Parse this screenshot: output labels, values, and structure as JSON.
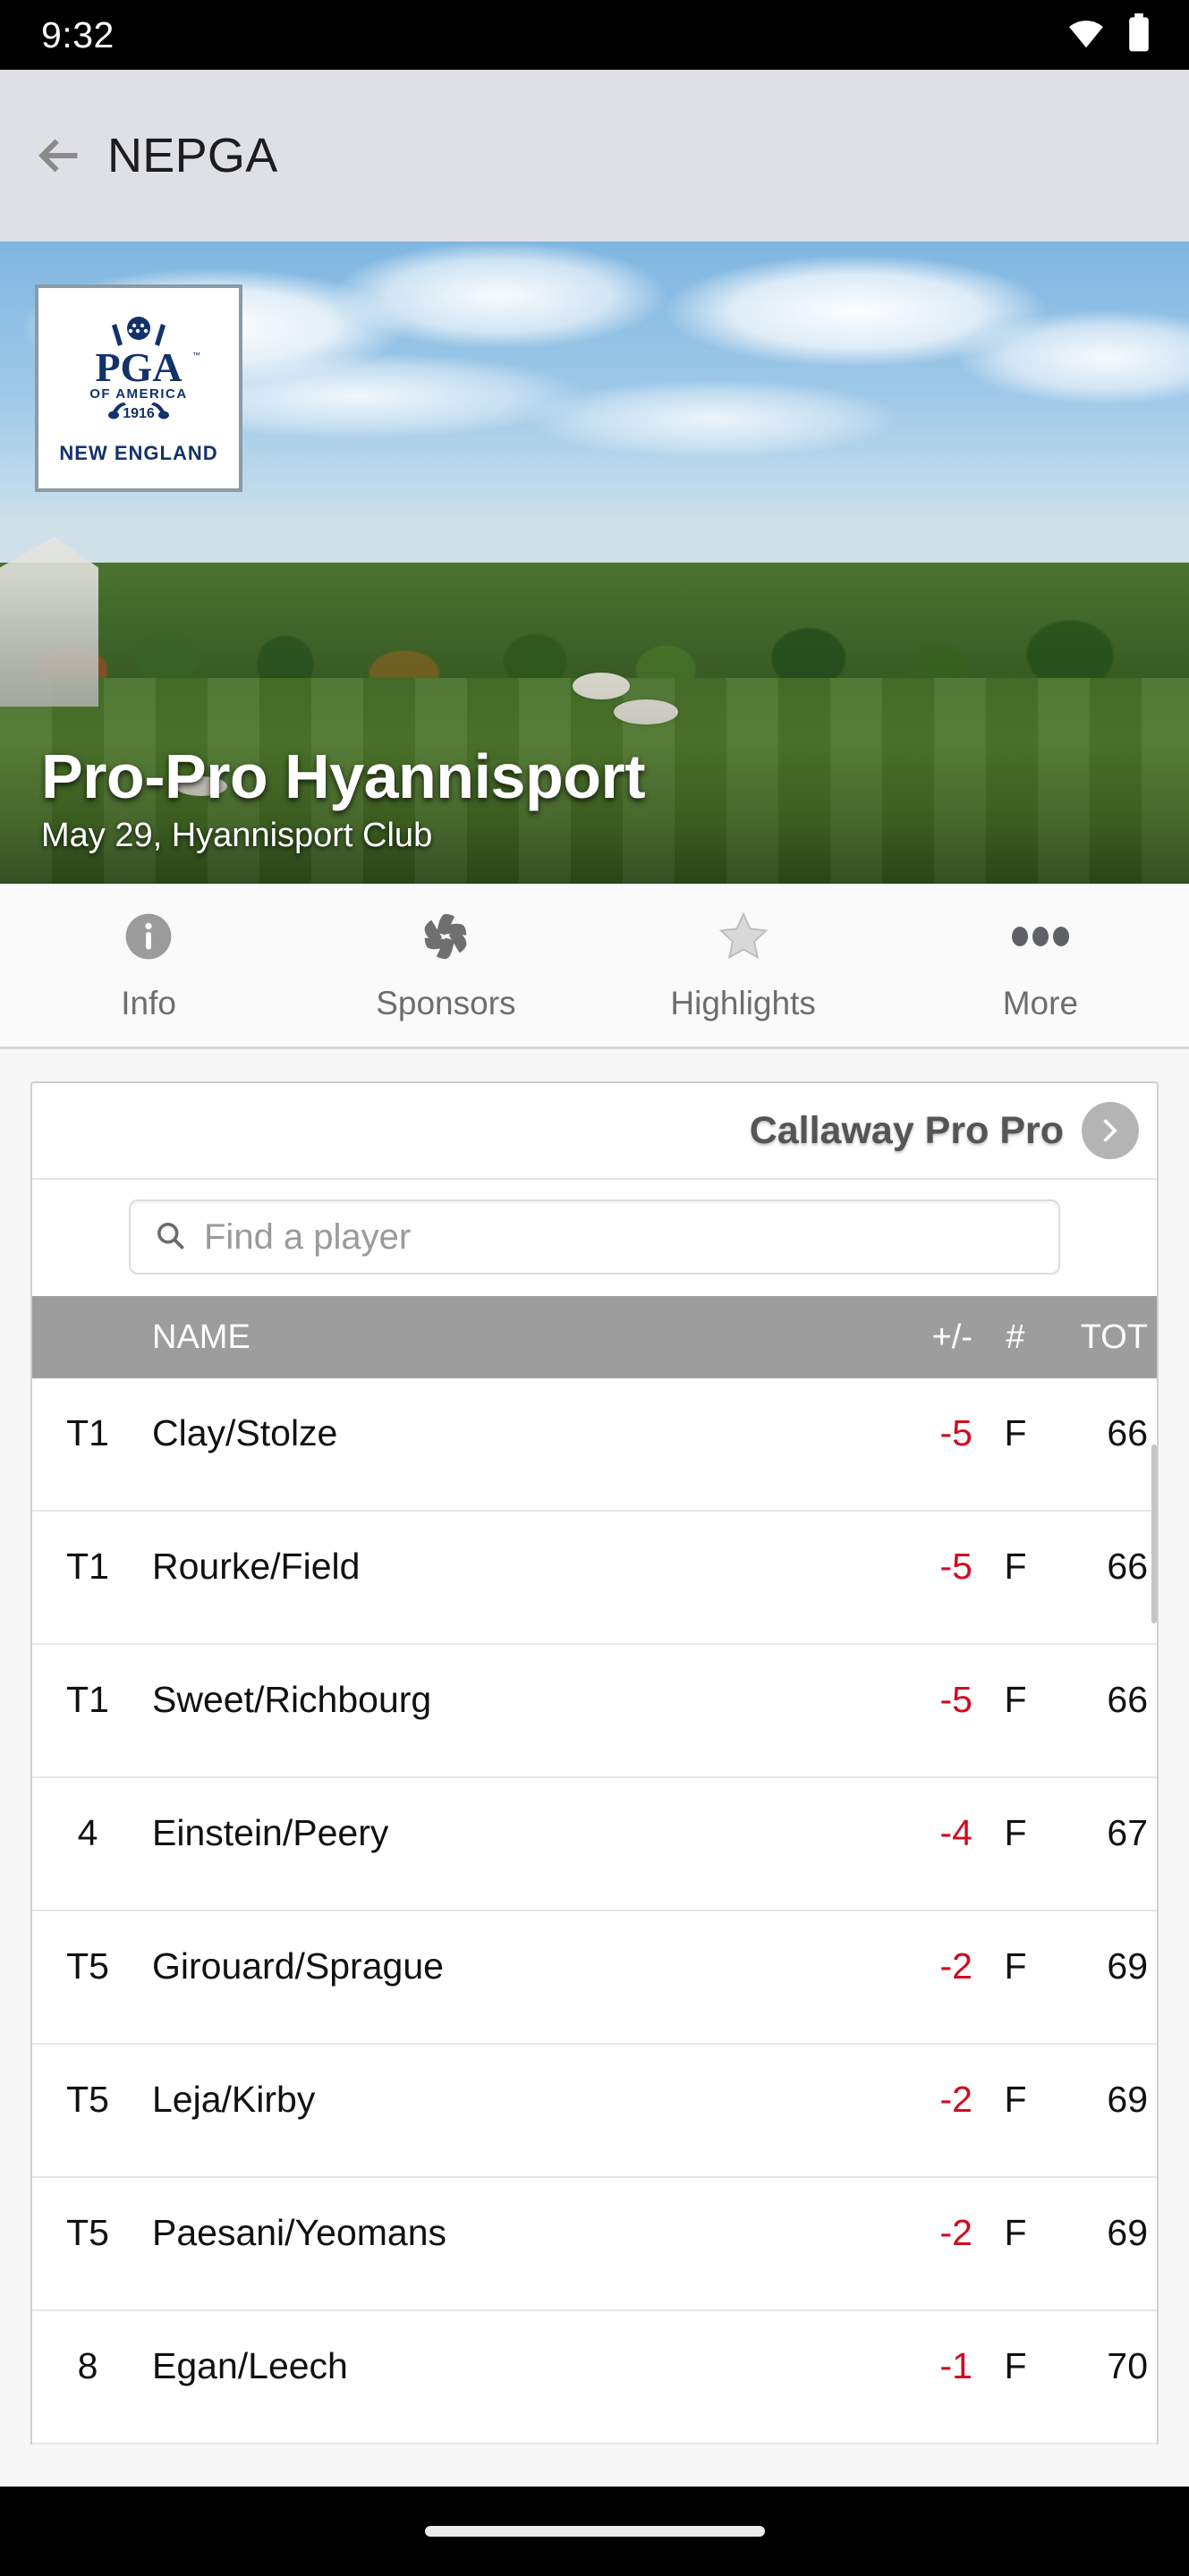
{
  "status_bar": {
    "time": "9:32",
    "wifi_icon": "wifi-icon",
    "battery_icon": "battery-icon"
  },
  "app_bar": {
    "back_icon": "back-arrow-icon",
    "title": "NEPGA"
  },
  "hero": {
    "title": "Pro-Pro Hyannisport",
    "subtitle": "May 29, Hyannisport Club",
    "logo": {
      "org": "PGA",
      "of_america": "OF AMERICA",
      "year": "1916",
      "section": "NEW ENGLAND",
      "icon": "pga-logo-icon"
    }
  },
  "tabs": [
    {
      "label": "Info",
      "icon": "info-circle-icon"
    },
    {
      "label": "Sponsors",
      "icon": "camera-aperture-icon"
    },
    {
      "label": "Highlights",
      "icon": "star-icon"
    },
    {
      "label": "More",
      "icon": "ellipsis-icon"
    }
  ],
  "leaderboard": {
    "title": "Callaway Pro Pro",
    "next_icon": "chevron-right-icon",
    "search": {
      "placeholder": "Find a player",
      "value": "",
      "icon": "search-icon"
    },
    "columns": {
      "pos": "",
      "name": "NAME",
      "plus_minus": "+/-",
      "hole": "#",
      "total": "TOT"
    },
    "rows": [
      {
        "pos": "T1",
        "name": "Clay/Stolze",
        "plus_minus": "-5",
        "hole": "F",
        "total": "66"
      },
      {
        "pos": "T1",
        "name": "Rourke/Field",
        "plus_minus": "-5",
        "hole": "F",
        "total": "66"
      },
      {
        "pos": "T1",
        "name": "Sweet/Richbourg",
        "plus_minus": "-5",
        "hole": "F",
        "total": "66"
      },
      {
        "pos": "4",
        "name": "Einstein/Peery",
        "plus_minus": "-4",
        "hole": "F",
        "total": "67"
      },
      {
        "pos": "T5",
        "name": "Girouard/Sprague",
        "plus_minus": "-2",
        "hole": "F",
        "total": "69"
      },
      {
        "pos": "T5",
        "name": "Leja/Kirby",
        "plus_minus": "-2",
        "hole": "F",
        "total": "69"
      },
      {
        "pos": "T5",
        "name": "Paesani/Yeomans",
        "plus_minus": "-2",
        "hole": "F",
        "total": "69"
      },
      {
        "pos": "8",
        "name": "Egan/Leech",
        "plus_minus": "-1",
        "hole": "F",
        "total": "70"
      }
    ]
  },
  "nav_bar": {
    "home_indicator": "home-indicator"
  },
  "colors": {
    "score_red": "#cf0d1e",
    "header_gray": "#9d9d9d",
    "appbar_gray": "#dfe0e6",
    "pga_navy": "#13326b",
    "chevron_gray": "#b4b4b4"
  }
}
